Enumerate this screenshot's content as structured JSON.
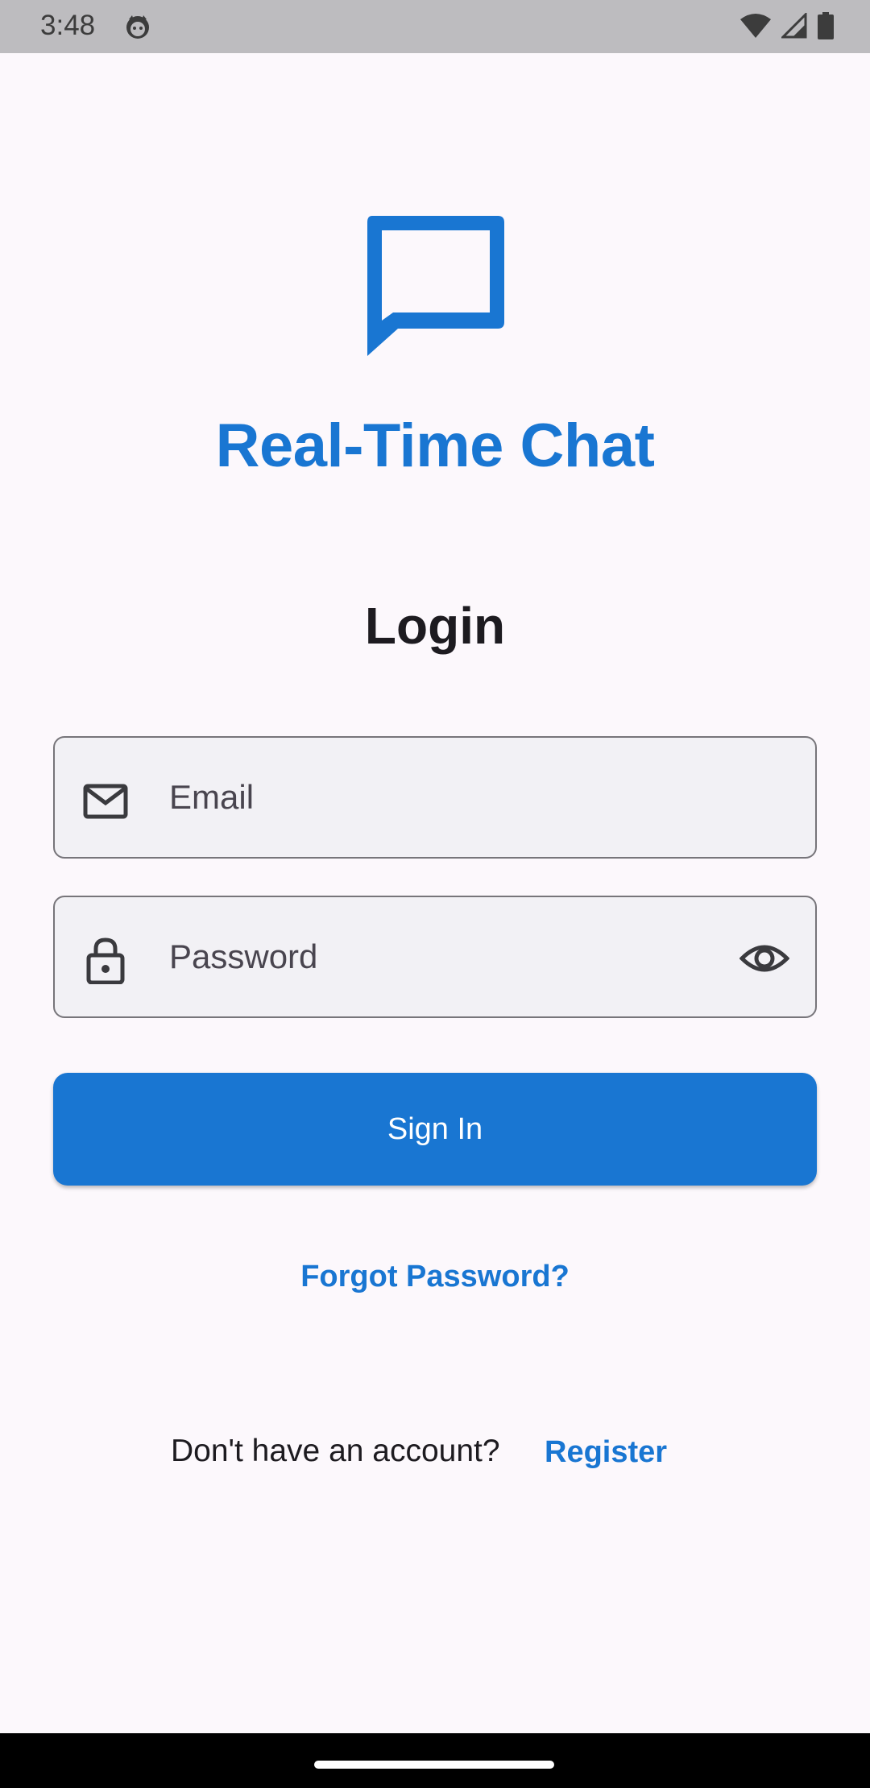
{
  "status_bar": {
    "time": "3:48",
    "icons": [
      "face-icon",
      "wifi-icon",
      "signal-icon",
      "battery-icon"
    ]
  },
  "app": {
    "logo_icon": "chat-bubble-icon",
    "title": "Real-Time Chat",
    "accent_color": "#1976d2"
  },
  "login": {
    "heading": "Login",
    "email": {
      "placeholder": "Email",
      "value": "",
      "icon": "mail-icon"
    },
    "password": {
      "placeholder": "Password",
      "value": "",
      "icon": "lock-icon",
      "toggle_icon": "eye-icon"
    },
    "sign_in_label": "Sign In",
    "forgot_label": "Forgot Password?",
    "register_prompt": "Don't have an account?",
    "register_label": "Register"
  }
}
